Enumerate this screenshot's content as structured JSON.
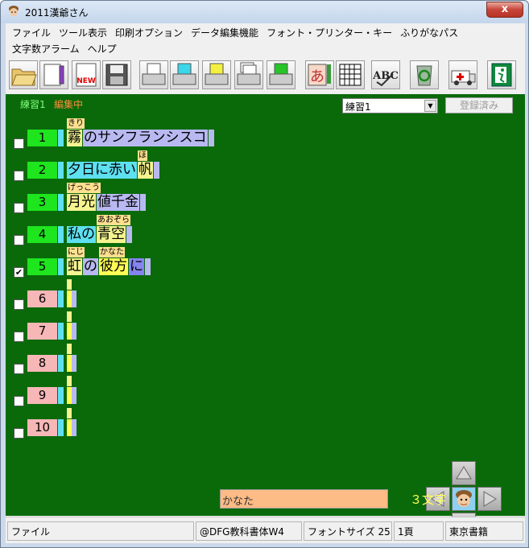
{
  "window": {
    "title": "2011漢爺さん",
    "close_label": "x"
  },
  "menu": {
    "row1": [
      "ファイル",
      "ツール表示",
      "印刷オプション",
      "データ編集機能",
      "フォント・プリンター・キー",
      "ふりがなパス"
    ],
    "row2": [
      "文字数アラーム",
      "ヘルプ"
    ]
  },
  "toolbar": {
    "icons": [
      "open-folder-icon",
      "pencil-page-icon",
      "new-page-icon",
      "save-disk-icon",
      "print-icon",
      "print-cyan-icon",
      "print-yellow-icon",
      "print-multi-icon",
      "print-green-icon",
      "a-pen-icon",
      "grid-icon",
      "abc-spell-icon",
      "recycle-bin-icon",
      "ambulance-icon",
      "exit-icon"
    ],
    "new_label": "NEW",
    "a_label": "あ",
    "abc_label": "ABC"
  },
  "panel": {
    "exercise_label": "練習1",
    "edit_label": "編集中",
    "select_value": "練習1",
    "register_label": "登録済み"
  },
  "rows": [
    {
      "num": "1",
      "checked": false,
      "segments": [
        {
          "text": "霧",
          "furi": "きり"
        },
        {
          "text": "のサンフランシスコ",
          "furi": ""
        }
      ]
    },
    {
      "num": "2",
      "checked": false,
      "segments": [
        {
          "text": "夕日に赤い",
          "furi": ""
        },
        {
          "text": "帆",
          "furi": "ほ"
        }
      ]
    },
    {
      "num": "3",
      "checked": false,
      "segments": [
        {
          "text": "月光",
          "furi": "げっこう"
        },
        {
          "text": "値千金",
          "furi": ""
        }
      ]
    },
    {
      "num": "4",
      "checked": false,
      "segments": [
        {
          "text": "私の",
          "furi": ""
        },
        {
          "text": "青空",
          "furi": "あおぞら"
        }
      ]
    },
    {
      "num": "5",
      "checked": true,
      "segments": [
        {
          "text": "虹",
          "furi": "にじ"
        },
        {
          "text": "の",
          "furi": ""
        },
        {
          "text": "彼方",
          "furi": "かなた"
        },
        {
          "text": "に",
          "furi": ""
        }
      ]
    },
    {
      "num": "6",
      "checked": false,
      "segments": []
    },
    {
      "num": "7",
      "checked": false,
      "segments": []
    },
    {
      "num": "8",
      "checked": false,
      "segments": []
    },
    {
      "num": "9",
      "checked": false,
      "segments": []
    },
    {
      "num": "10",
      "checked": false,
      "segments": []
    }
  ],
  "editor": {
    "furigana_value": "かなた",
    "char_count": "３文字"
  },
  "dpad": [
    "up-arrow-icon",
    "left-arrow-icon",
    "character-icon",
    "right-arrow-icon",
    "down-arrow-icon"
  ],
  "status": {
    "mode": "ファイル",
    "font": "@DFG教科書体W4",
    "font_size": "フォントサイズ 25",
    "page": "1頁",
    "publisher": "東京書籍"
  },
  "colors": {
    "background": "#0a6a0a",
    "number_active": "#1ee51e",
    "number_empty": "#f7b7b7",
    "furigana": "#ffe090",
    "label_green": "#7dff7d",
    "label_orange": "#ff8c3a",
    "count_yellow": "#ffff55"
  }
}
